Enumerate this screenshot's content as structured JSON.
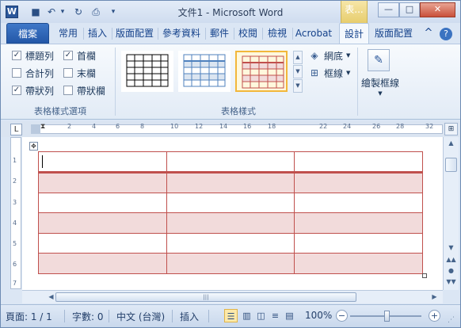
{
  "window": {
    "title": "文件1 - Microsoft Word",
    "contextual_tab_label": "表...",
    "app_icon_letter": "W",
    "controls": {
      "minimize": "—",
      "maximize": "□",
      "close": "✕"
    }
  },
  "quick_access": [
    {
      "name": "save-icon",
      "glyph": "■"
    },
    {
      "name": "undo-icon",
      "glyph": "↶"
    },
    {
      "name": "undo-dropdown-icon",
      "glyph": "▾"
    },
    {
      "name": "redo-icon",
      "glyph": "↻"
    },
    {
      "name": "print-preview-icon",
      "glyph": "⎙"
    },
    {
      "name": "customize-qat-icon",
      "glyph": "▾"
    }
  ],
  "tabs": [
    "檔案",
    "常用",
    "插入",
    "版面配置",
    "參考資料",
    "郵件",
    "校閱",
    "檢視",
    "Acrobat",
    "設計",
    "版面配置"
  ],
  "active_tab": "設計",
  "ribbon": {
    "help_glyph": "?",
    "collapse_glyph": "^",
    "style_options": {
      "label": "表格樣式選項",
      "items": [
        {
          "label": "標題列",
          "checked": true
        },
        {
          "label": "首欄",
          "checked": true
        },
        {
          "label": "合計列",
          "checked": false
        },
        {
          "label": "末欄",
          "checked": false
        },
        {
          "label": "帶狀列",
          "checked": true
        },
        {
          "label": "帶狀欄",
          "checked": false
        }
      ]
    },
    "table_styles": {
      "label": "表格樣式",
      "swatches": [
        {
          "name": "plain-grid",
          "color": "#000000"
        },
        {
          "name": "blue-grid",
          "color": "#4f81bd"
        },
        {
          "name": "red-grid",
          "color": "#c0504d",
          "selected": true
        }
      ],
      "shading_label": "網底",
      "borders_label": "框線"
    },
    "draw_borders": {
      "label": "繪製框線"
    }
  },
  "ruler": {
    "ticks": [
      "2",
      "4",
      "6",
      "8",
      "10",
      "12",
      "14",
      "16",
      "18",
      "22",
      "24",
      "26",
      "28",
      "32"
    ],
    "vticks": [
      "1",
      "2",
      "3",
      "4",
      "5",
      "6",
      "7"
    ],
    "tab_selector": "L"
  },
  "document": {
    "table": {
      "rows": 6,
      "cols": 3,
      "banded_rows": true,
      "accent": "#c0504d",
      "band_fill": "#f2dbdb"
    }
  },
  "statusbar": {
    "page": "頁面: 1 / 1",
    "words": "字數: 0",
    "language": "中文 (台灣)",
    "mode": "插入",
    "zoom": "100%",
    "zoom_out": "−",
    "zoom_in": "+"
  }
}
